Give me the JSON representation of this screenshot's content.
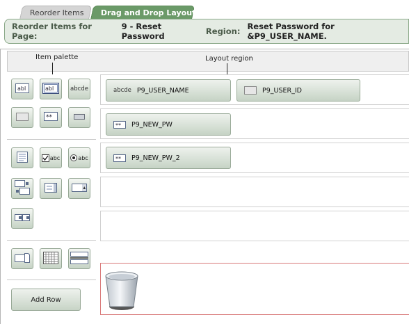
{
  "tabs": [
    {
      "label": "Reorder Items",
      "active": false
    },
    {
      "label": "Drag and Drop Layout",
      "active": true
    }
  ],
  "header": {
    "page_label": "Reorder Items for Page:",
    "page_value": "9 - Reset Password",
    "region_label": "Region:",
    "region_value": "Reset Password for &P9_USER_NAME."
  },
  "columns": {
    "palette": "Item palette",
    "layout": "Layout region"
  },
  "palette": {
    "items": [
      {
        "name": "text-field-icon",
        "text": "abl"
      },
      {
        "name": "text-field-selected-icon",
        "text": "abl"
      },
      {
        "name": "display-only-icon",
        "text": "abcde"
      },
      {
        "name": "hidden-item-icon"
      },
      {
        "name": "password-icon",
        "text": "**"
      },
      {
        "name": "small-field-icon"
      },
      {
        "name": "textarea-icon"
      },
      {
        "name": "checkbox-icon",
        "text": "abc"
      },
      {
        "name": "radio-icon",
        "text": "abc"
      },
      {
        "name": "shuttle-icon"
      },
      {
        "name": "list-icon"
      },
      {
        "name": "select-list-icon"
      },
      {
        "name": "multi-select-icon"
      },
      {
        "name": "file-browse-icon"
      },
      {
        "name": "grid-icon"
      },
      {
        "name": "stop-start-icon"
      }
    ],
    "add_row": "Add Row"
  },
  "layout": {
    "rows": [
      [
        {
          "label": "P9_USER_NAME",
          "icon": "display-only",
          "icon_text": "abcde"
        },
        {
          "label": "P9_USER_ID",
          "icon": "hidden"
        }
      ],
      [
        {
          "label": "P9_NEW_PW",
          "icon": "password",
          "icon_text": "**"
        }
      ],
      [
        {
          "label": "P9_NEW_PW_2",
          "icon": "password",
          "icon_text": "**"
        }
      ]
    ]
  },
  "colors": {
    "active_tab": "#6b9a68",
    "header_bg": "#e4ebe3",
    "trash_border": "#d97a7a"
  }
}
